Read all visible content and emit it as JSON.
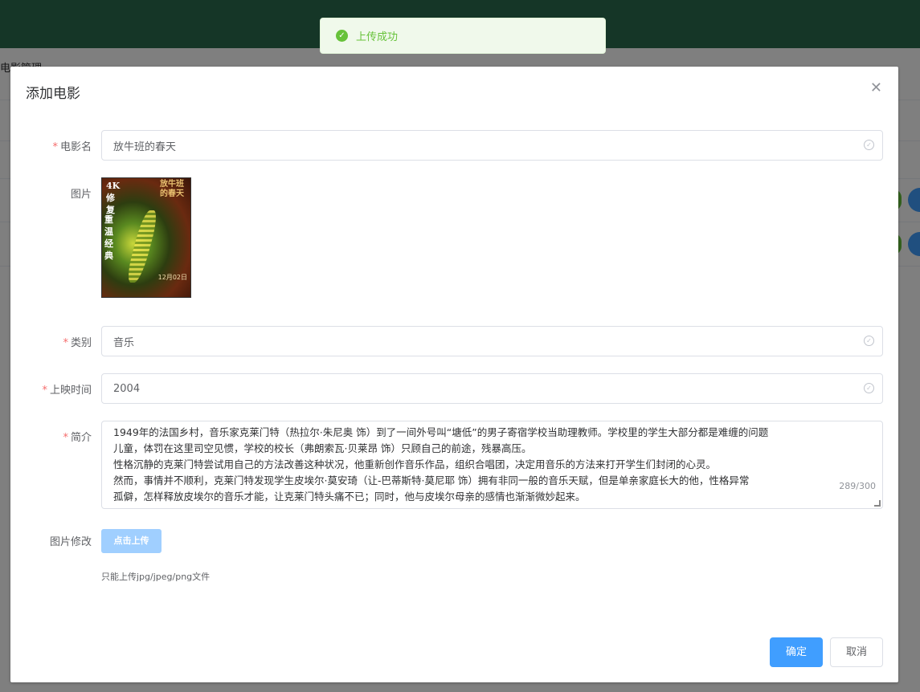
{
  "background": {
    "breadcrumb": "电影管理"
  },
  "toast": {
    "icon": "check-circle-icon",
    "message": "上传成功"
  },
  "dialog": {
    "title": "添加电影",
    "close_icon": "close-icon",
    "fields": {
      "name": {
        "label": "电影名",
        "value": "放牛班的春天",
        "required": true
      },
      "image": {
        "label": "图片"
      },
      "category": {
        "label": "类别",
        "value": "音乐",
        "required": true
      },
      "release": {
        "label": "上映时间",
        "value": "2004",
        "required": true
      },
      "intro": {
        "label": "简介",
        "required": true,
        "lines": [
          "1949年的法国乡村，音乐家克莱门特（热拉尔·朱尼奥 饰）到了一间外号叫“塘低”的男子寄宿学校当助理教师。学校里的学生大部分都是难缠的问题",
          "儿童，体罚在这里司空见惯，学校的校长（弗朗索瓦·贝莱昂 饰）只顾自己的前途，残暴高压。",
          "性格沉静的克莱门特尝试用自己的方法改善这种状况，他重新创作音乐作品，组织合唱团，决定用音乐的方法来打开学生们封闭的心灵。",
          "然而，事情并不顺利，克莱门特发现学生皮埃尔·莫安琦（让-巴蒂斯特·莫尼耶 饰）拥有非同一般的音乐天赋，但是单亲家庭长大的他，性格异常",
          "孤僻，怎样释放皮埃尔的音乐才能，让克莱门特头痛不已；同时，他与皮埃尔母亲的感情也渐渐微妙起来。"
        ],
        "word_count": "289/300"
      },
      "image_edit": {
        "label": "图片修改",
        "button": "点击上传",
        "tip": "只能上传jpg/jpeg/png文件"
      }
    },
    "poster": {
      "top_text": "4K修复",
      "sub_text": "重温经典",
      "title": "放牛班的春天",
      "date": "12月02日"
    },
    "buttons": {
      "confirm": "确定",
      "cancel": "取消"
    }
  },
  "colors": {
    "header": "#2b6d4f",
    "primary": "#409eff",
    "success": "#67c23a",
    "required": "#f56c6c"
  }
}
